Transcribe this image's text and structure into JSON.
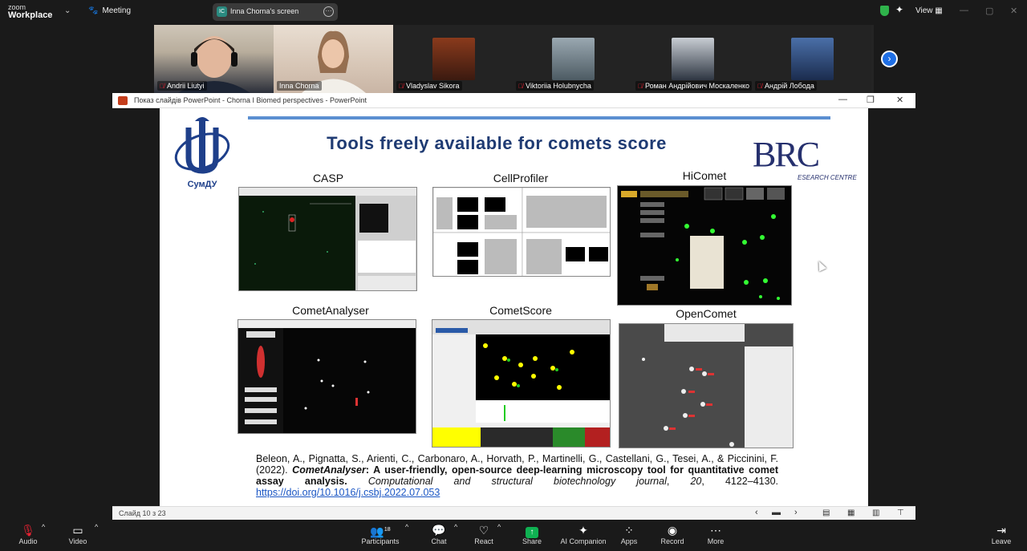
{
  "app": {
    "brand_line1": "zoom",
    "brand_line2": "Workplace",
    "meeting_label": "Meeting",
    "share_label": "Inna Chorna's screen",
    "share_icon_text": "IC",
    "view_label": "View"
  },
  "participants": [
    {
      "name": "Andrii Liutyi",
      "muted": true
    },
    {
      "name": "Inna Chorna",
      "muted": false
    },
    {
      "name": "Vladyslav Sikora",
      "muted": true
    },
    {
      "name": "Viktoriia Holubnycha",
      "muted": true
    },
    {
      "name": "Роман Андрійович Москаленко",
      "muted": true
    },
    {
      "name": "Андрій Лобода",
      "muted": true
    }
  ],
  "ppt": {
    "window_title": "Показ слайдів PowerPoint  -  Chorna I Biomed perspectives - PowerPoint",
    "status_slide": "Слайд 10 з 23"
  },
  "slide": {
    "title": "Tools freely available for comets score",
    "logo_left_caption": "СумДУ",
    "logo_right_text": "BRC",
    "logo_right_sub": "ESEARCH CENTRE",
    "tools": [
      "CASP",
      "CellProfiler",
      "HiComet",
      "CometAnalyser",
      "CometScore",
      "OpenComet"
    ],
    "citation": {
      "authors": "Beleon, A., Pignatta, S., Arienti, C., Carbonaro, A., Horvath, P., Martinelli, G., Castellani, G., Tesei, A., & Piccinini, F. (2022).",
      "title_italic": "CometAnalyser",
      "title_rest": ": A user-friendly, open-source deep-learning microscopy tool for quantitative comet assay analysis.",
      "journal": "Computational and structural biotechnology journal",
      "volume": "20",
      "pages": ", 4122–4130.",
      "doi": "https://doi.org/10.1016/j.csbj.2022.07.053"
    }
  },
  "toolbar": {
    "audio": "Audio",
    "video": "Video",
    "participants": "Participants",
    "participants_count": "18",
    "chat": "Chat",
    "react": "React",
    "share": "Share",
    "ai": "AI Companion",
    "apps": "Apps",
    "record": "Record",
    "more": "More",
    "leave": "Leave"
  }
}
